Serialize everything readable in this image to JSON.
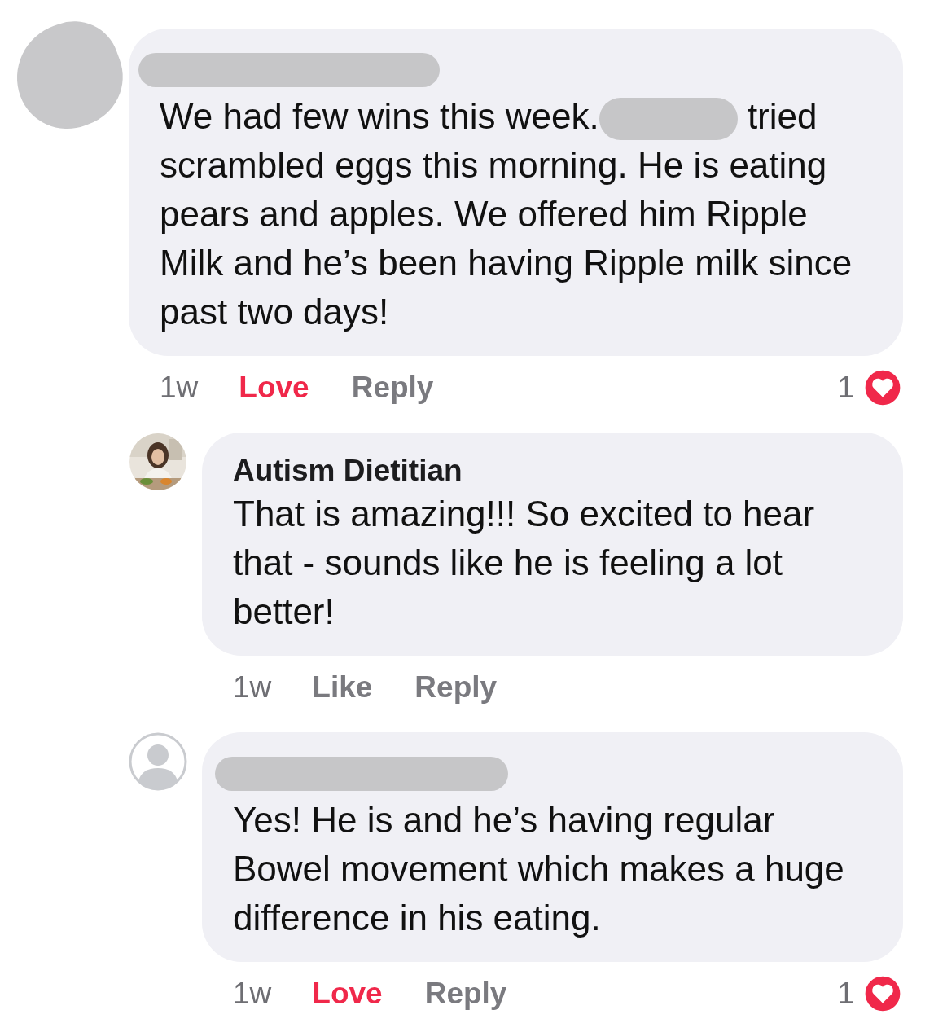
{
  "comments": [
    {
      "avatar": {
        "kind": "redacted"
      },
      "author_hidden": true,
      "text": "We had few wins this week.",
      "text_after": "tried scrambled eggs this morning. He is eating pears and apples. We offered him Ripple Milk and he’s been having Ripple milk since past two days!",
      "time": "1w",
      "reaction": {
        "label": "Love",
        "reacted": true
      },
      "reply": "Reply",
      "reaction_count": "1",
      "children": [
        {
          "author": "Autism Dietitian",
          "text": "That is amazing!!! So excited to hear that - sounds like he is feeling a lot better!",
          "time": "1w",
          "reaction": {
            "label": "Like",
            "reacted": false
          },
          "reply": "Reply"
        },
        {
          "avatar": {
            "kind": "silhouette"
          },
          "author_hidden": true,
          "text": "Yes! He is and he’s having regular Bowel movement which makes a huge difference in his eating.",
          "time": "1w",
          "reaction": {
            "label": "Love",
            "reacted": true
          },
          "reply": "Reply",
          "reaction_count": "1"
        }
      ]
    }
  ]
}
